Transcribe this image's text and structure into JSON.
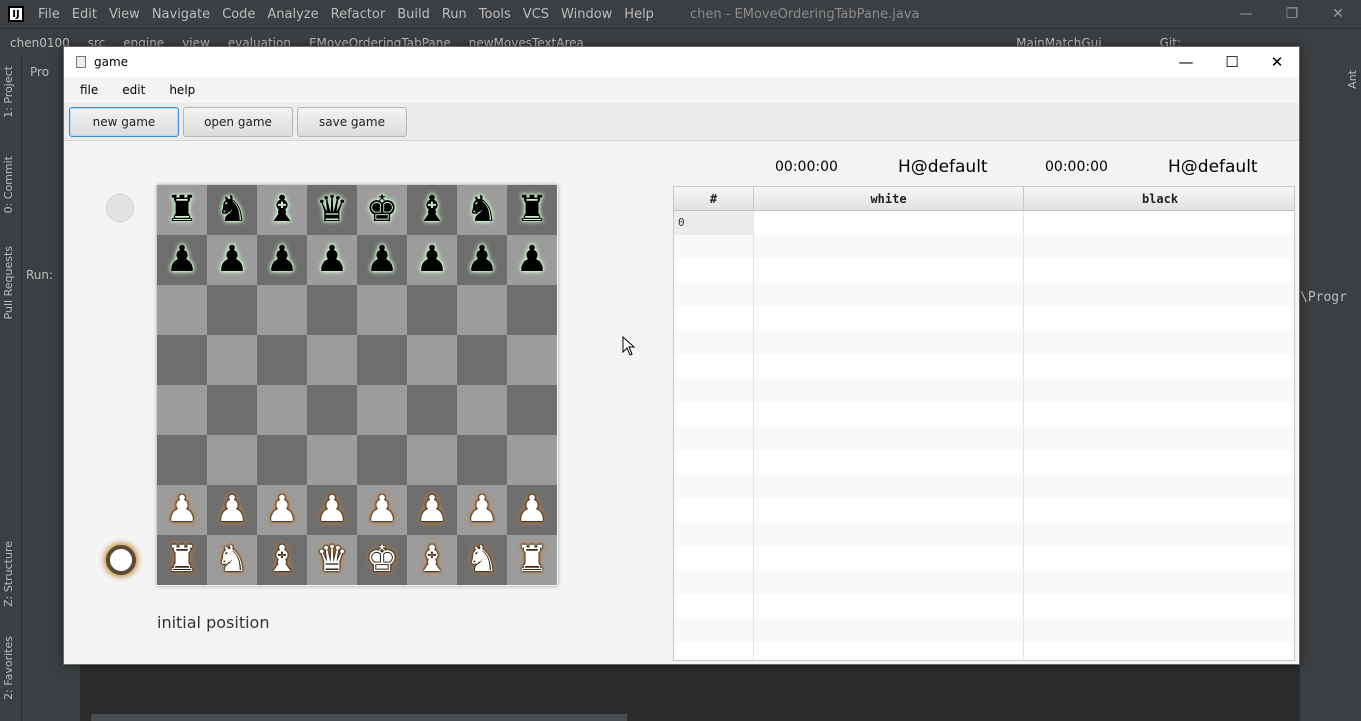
{
  "ide": {
    "menu": [
      "File",
      "Edit",
      "View",
      "Navigate",
      "Code",
      "Analyze",
      "Refactor",
      "Build",
      "Run",
      "Tools",
      "VCS",
      "Window",
      "Help"
    ],
    "title": "chen - EMoveOrderingTabPane.java",
    "breadcrumb": [
      "chen0100",
      "src",
      "engine",
      "view",
      "evaluation",
      "EMoveOrderingTabPane",
      "newMovesTextArea"
    ],
    "run_config": "MainMatchGui",
    "git_label": "Git:",
    "left_tabs": [
      "1: Project",
      "0: Commit",
      "Pull Requests",
      "Z: Structure",
      "2: Favorites"
    ],
    "right_tabs": [
      "Ant"
    ],
    "run_label": "Run:",
    "project_tab": "Pro",
    "console_text": "\\Progr"
  },
  "game_window": {
    "title": "game",
    "menu": [
      "file",
      "edit",
      "help"
    ],
    "toolbar": {
      "new_game": "new game",
      "open_game": "open game",
      "save_game": "save game"
    },
    "clock_white": "00:00:00",
    "player_white": "H@default",
    "clock_black": "00:00:00",
    "player_black": "H@default",
    "status": "initial position"
  },
  "board": {
    "ranks": [
      [
        "bR",
        "bN",
        "bB",
        "bQ",
        "bK",
        "bB",
        "bN",
        "bR"
      ],
      [
        "bP",
        "bP",
        "bP",
        "bP",
        "bP",
        "bP",
        "bP",
        "bP"
      ],
      [
        "",
        "",
        "",
        "",
        "",
        "",
        "",
        ""
      ],
      [
        "",
        "",
        "",
        "",
        "",
        "",
        "",
        ""
      ],
      [
        "",
        "",
        "",
        "",
        "",
        "",
        "",
        ""
      ],
      [
        "",
        "",
        "",
        "",
        "",
        "",
        "",
        ""
      ],
      [
        "wP",
        "wP",
        "wP",
        "wP",
        "wP",
        "wP",
        "wP",
        "wP"
      ],
      [
        "wR",
        "wN",
        "wB",
        "wQ",
        "wK",
        "wB",
        "wN",
        "wR"
      ]
    ],
    "side_to_move": "white"
  },
  "moves_table": {
    "columns": [
      "#",
      "white",
      "black"
    ],
    "rows": [
      {
        "num": "0",
        "white": "",
        "black": ""
      }
    ]
  }
}
